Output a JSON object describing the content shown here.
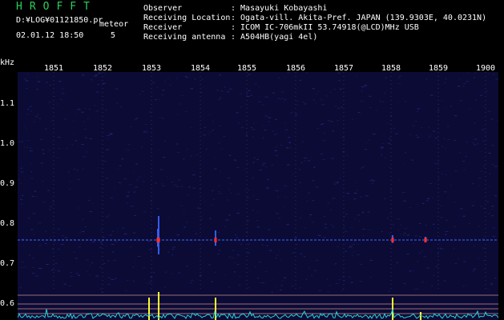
{
  "header": {
    "app_title": "HROFFT",
    "log_path": "D:¥LOG¥01121850.pr",
    "meteor_label": "meteor",
    "datetime": "02.01.12 18:50",
    "meteor_count": "5",
    "fields": [
      {
        "label": "Observer",
        "value": ": Masayuki Kobayashi"
      },
      {
        "label": "Receiving Location",
        "value": ": Ogata-vill. Akita-Pref. JAPAN (139.9303E, 40.0231N)"
      },
      {
        "label": "Receiver",
        "value": ": ICOM IC-706mkII 53.74918(@LCD)MHz USB"
      },
      {
        "label": "Receiving antenna",
        "value": ": A504HB(yagi 4el)"
      }
    ]
  },
  "chart_data": {
    "type": "heatmap",
    "ylabel": "kHz",
    "x_ticks": [
      "1851",
      "1852",
      "1853",
      "1854",
      "1855",
      "1856",
      "1857",
      "1858",
      "1859",
      "1900"
    ],
    "y_ticks": [
      "1.1",
      "1.0",
      "0.9",
      "0.8",
      "0.7",
      "0.6"
    ],
    "ylim": [
      0.58,
      1.2
    ],
    "carrier_khz": 0.76,
    "echoes": [
      {
        "time": "1853",
        "strength": "strong"
      },
      {
        "time": "1853",
        "strength": "medium"
      },
      {
        "time": "1854",
        "strength": "medium"
      },
      {
        "time": "1858",
        "strength": "weak"
      },
      {
        "time": "1859",
        "strength": "weak"
      }
    ],
    "colors": {
      "background": "#0b0b35",
      "noise": "#2a2a8a",
      "carrier": "#3b63ff",
      "echo": "#ff3030",
      "trace": "#ffff30",
      "baseline": "#ffb0a0",
      "level": "#2ad0d8",
      "grid": "#5a5a8a"
    }
  }
}
